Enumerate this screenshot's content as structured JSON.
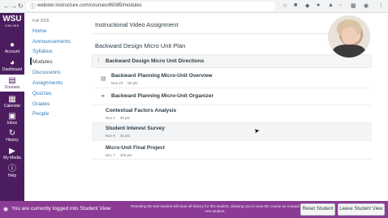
{
  "browser": {
    "url": "webster.instructure.com/courses/65085/modules"
  },
  "global_nav": {
    "logo_main": "WSU",
    "logo_sub": "ONLINE",
    "items": [
      {
        "label": "Account",
        "icon": "account-icon"
      },
      {
        "label": "Dashboard",
        "icon": "dashboard-icon"
      },
      {
        "label": "Courses",
        "icon": "courses-icon"
      },
      {
        "label": "Calendar",
        "icon": "calendar-icon"
      },
      {
        "label": "Inbox",
        "icon": "inbox-icon"
      },
      {
        "label": "History",
        "icon": "history-icon"
      },
      {
        "label": "My Media",
        "icon": "media-icon"
      },
      {
        "label": "Help",
        "icon": "help-icon"
      }
    ],
    "active_index": 2
  },
  "course_nav": {
    "term": "Fall 2025",
    "links": [
      "Home",
      "Announcements",
      "Syllabus",
      "Modules",
      "Discussions",
      "Assignments",
      "Quizzes",
      "Grades",
      "People"
    ],
    "active": "Modules"
  },
  "main": {
    "assignment_title": "Instructional Video Assignment",
    "page_title": "Backward Design Micro Unit Plan",
    "module_header": "Backward Design Micro Unit Directions",
    "items": [
      {
        "title": "Backward Planning Micro-Unit Overview",
        "date": "Nov 23",
        "points": "50 pts"
      },
      {
        "title": "Backward Planning Micro-Unit Organizer",
        "date": "",
        "points": ""
      },
      {
        "title": "Contextual Factors Analysis",
        "date": "Nov 2",
        "points": "30 pts"
      },
      {
        "title": "Student Interest Survey",
        "date": "Nov 9",
        "points": "15 pts"
      },
      {
        "title": "Micro-Unit Final Project",
        "date": "Dec 7",
        "points": "100 pts"
      }
    ]
  },
  "student_view": {
    "message": "You are currently logged into Student View",
    "note": "Resetting the test student will clear all history for this student, allowing you to view the course as a brand new student.",
    "reset_label": "Reset Student",
    "leave_label": "Leave Student View"
  },
  "colors": {
    "nav_purple": "#4b1d5e",
    "student_bar": "#8b3a95",
    "link_blue": "#2b7abc"
  }
}
